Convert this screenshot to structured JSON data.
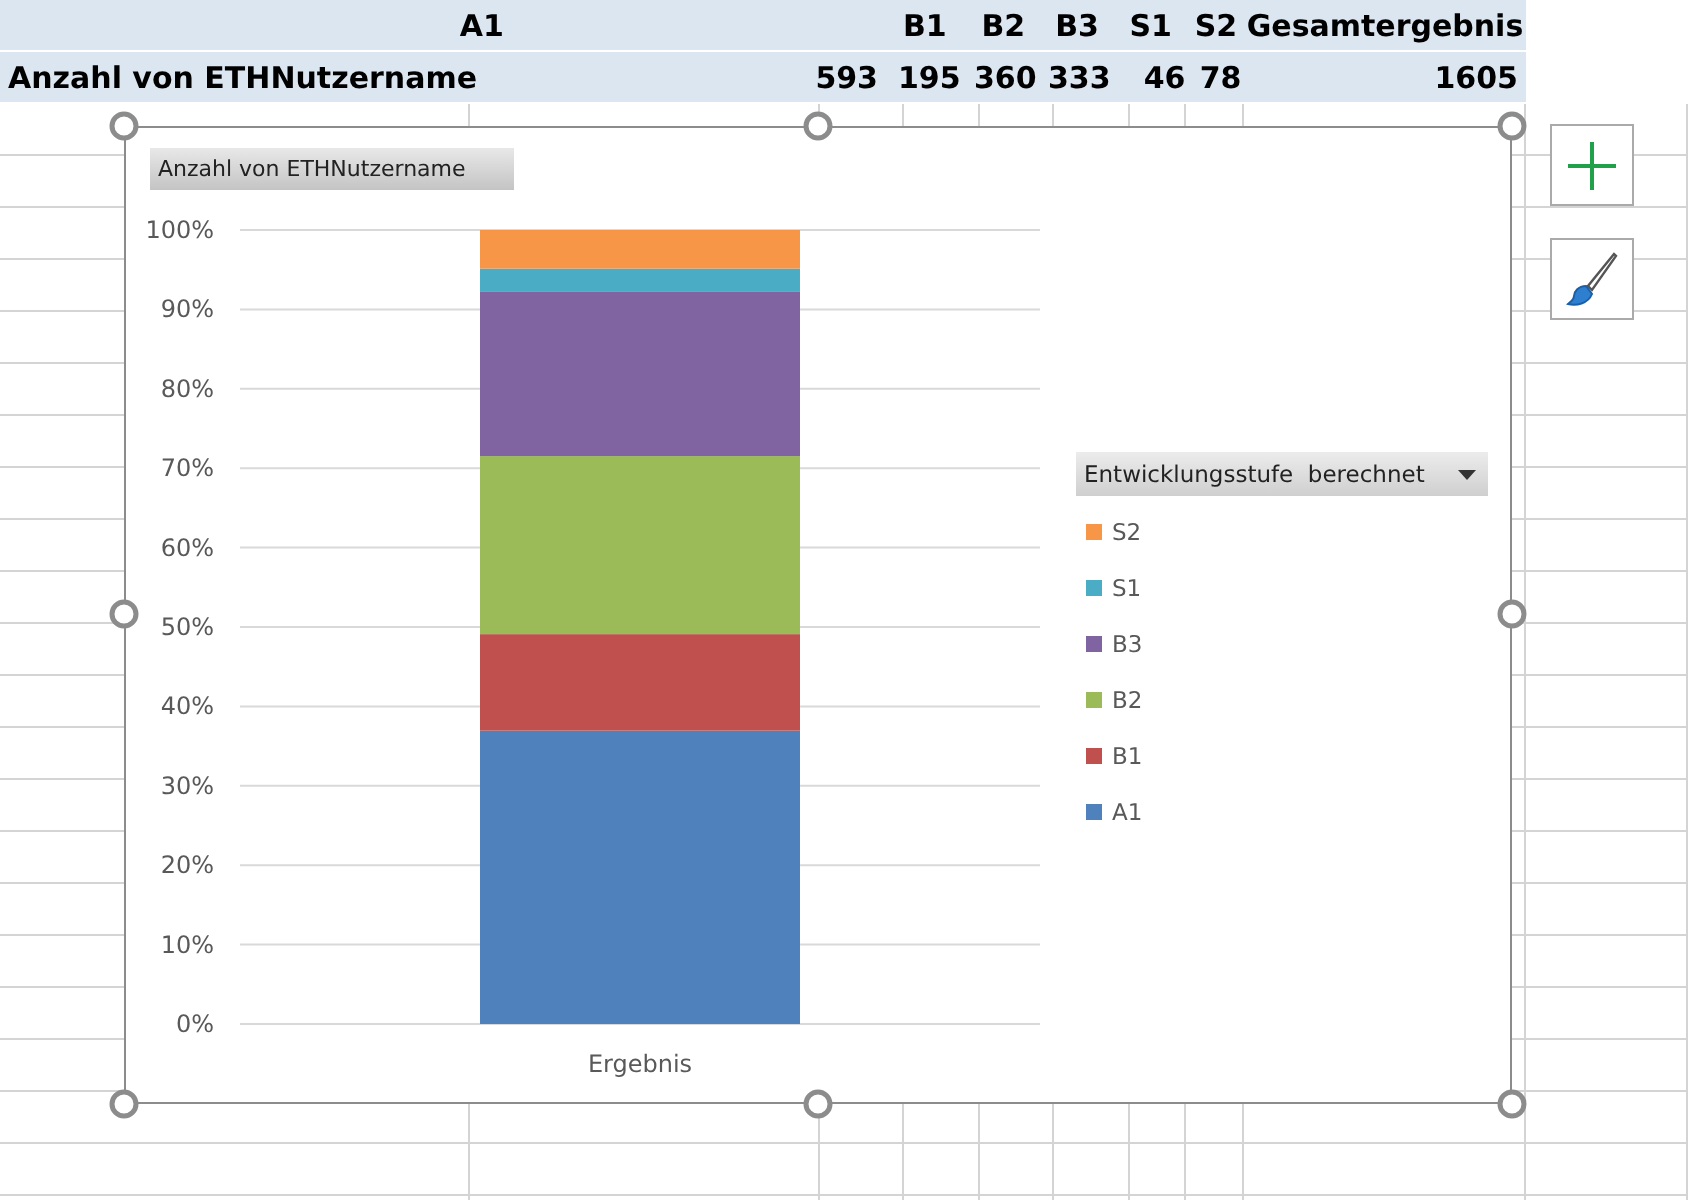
{
  "pivot_header": {
    "column_1": "A1",
    "columns": [
      "B1",
      "B2",
      "B3",
      "S1",
      "S2"
    ],
    "total_label": "Gesamtergebnis"
  },
  "pivot_row": {
    "label": "Anzahl von ETHNutzername",
    "first_value": "593",
    "values": [
      "195",
      "360",
      "333",
      "46",
      "78"
    ],
    "total": "1605"
  },
  "chart": {
    "field_button": "Anzahl von ETHNutzername",
    "legend_title": "Entwicklungsstufe  berechnet",
    "chart_data": {
      "type": "bar",
      "stacked": true,
      "grid": true,
      "categories": [
        "Ergebnis"
      ],
      "ylim": [
        0,
        100
      ],
      "yticks": [
        {
          "value": 0,
          "label": "0%"
        },
        {
          "value": 10,
          "label": "10%"
        },
        {
          "value": 20,
          "label": "20%"
        },
        {
          "value": 30,
          "label": "30%"
        },
        {
          "value": 40,
          "label": "40%"
        },
        {
          "value": 50,
          "label": "50%"
        },
        {
          "value": 60,
          "label": "60%"
        },
        {
          "value": 70,
          "label": "70%"
        },
        {
          "value": 80,
          "label": "80%"
        },
        {
          "value": 90,
          "label": "90%"
        },
        {
          "value": 100,
          "label": "100%"
        }
      ],
      "series": [
        {
          "name": "A1",
          "color": "#4f81bd",
          "values": [
            36.95
          ]
        },
        {
          "name": "B1",
          "color": "#c0504d",
          "values": [
            12.15
          ]
        },
        {
          "name": "B2",
          "color": "#9bbb59",
          "values": [
            22.43
          ]
        },
        {
          "name": "B3",
          "color": "#8064a2",
          "values": [
            20.75
          ]
        },
        {
          "name": "S1",
          "color": "#4bacc6",
          "values": [
            2.87
          ]
        },
        {
          "name": "S2",
          "color": "#f79646",
          "values": [
            4.85
          ]
        }
      ]
    }
  }
}
